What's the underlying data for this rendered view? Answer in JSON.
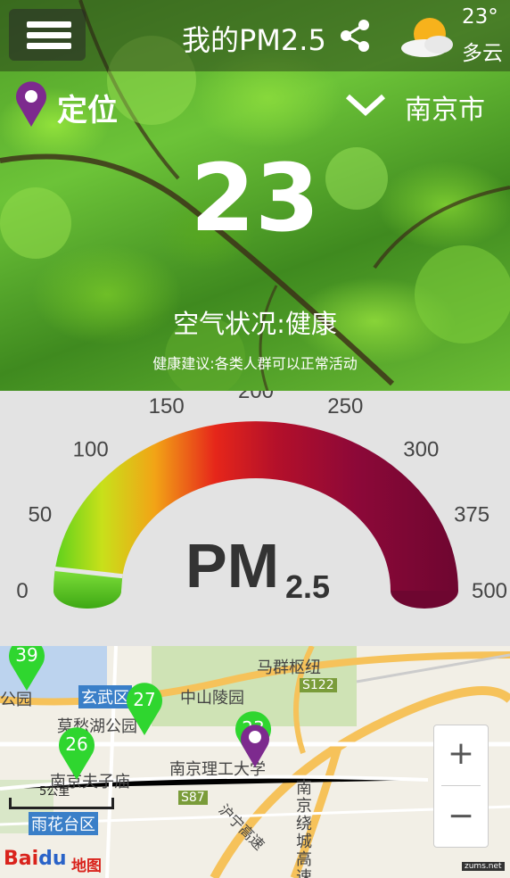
{
  "header": {
    "title": "我的PM2.5",
    "weather": {
      "temperature": "23°",
      "condition": "多云",
      "icon": "partly-cloudy-icon"
    }
  },
  "location": {
    "label": "定位",
    "city": "南京市"
  },
  "reading": {
    "value": "23",
    "air_status": "空气状况:健康",
    "advice": "健康建议:各类人群可以正常活动"
  },
  "gauge": {
    "ticks": [
      "0",
      "50",
      "100",
      "150",
      "200",
      "250",
      "300",
      "375",
      "500"
    ],
    "label_main": "PM",
    "label_sub": "2.5",
    "value": 23
  },
  "map": {
    "labels": [
      "马群枢纽",
      "中山陵园",
      "玄武区",
      "莫愁湖公园",
      "南京夫子庙",
      "南京理工大学",
      "雨花台区",
      "S122",
      "S87",
      "南京绕城高速",
      "沪宁高速",
      "公园"
    ],
    "markers": [
      "39",
      "27",
      "26",
      "23"
    ],
    "scale": "5公里",
    "zoom_in": "+",
    "zoom_out": "−",
    "logo_a": "Bai",
    "logo_b": "du",
    "logo_c": "地图",
    "watermark": "zums.net"
  }
}
